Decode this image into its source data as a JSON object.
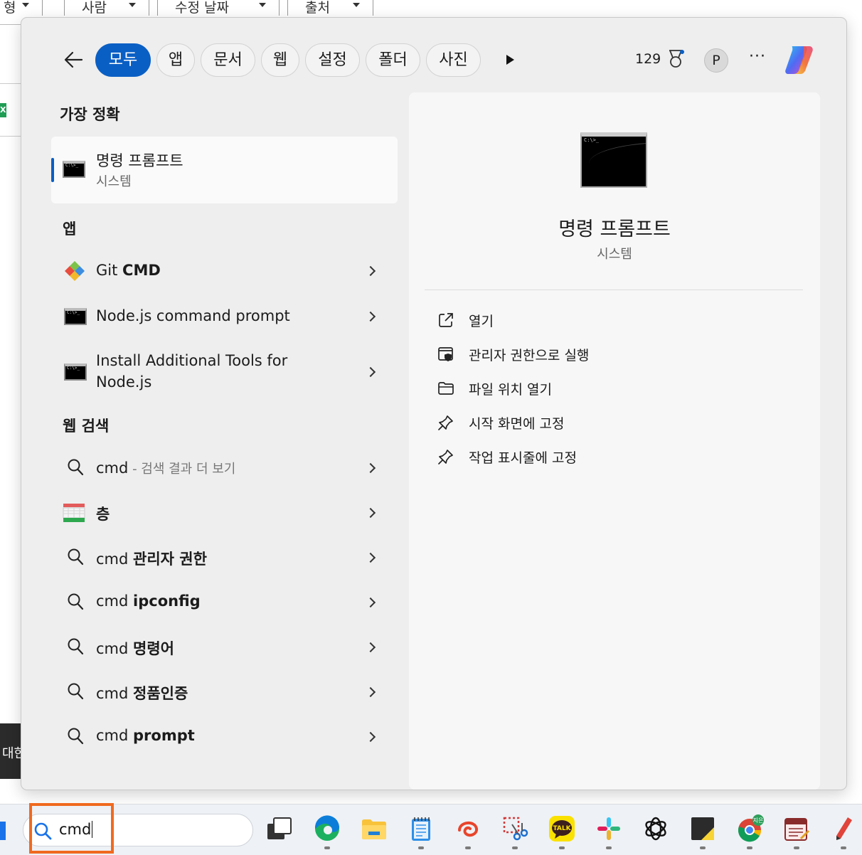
{
  "background_window": {
    "columns": [
      "형",
      "사람",
      "수정 날짜",
      "출처"
    ],
    "tooltip_text": "대한"
  },
  "filters": {
    "chips": [
      "모두",
      "앱",
      "문서",
      "웹",
      "설정",
      "폴더",
      "사진"
    ],
    "active": "모두",
    "points": "129",
    "avatar_initial": "P",
    "more": "···"
  },
  "best_match": {
    "heading": "가장 정확",
    "title": "명령 프롬프트",
    "subtitle": "시스템"
  },
  "apps": {
    "heading": "앱",
    "items": [
      {
        "prefix": "Git ",
        "bold": "CMD"
      },
      {
        "line1": "Node.js command prompt"
      },
      {
        "line1": "Install Additional Tools for",
        "line2": "Node.js"
      }
    ]
  },
  "web": {
    "heading": "웹 검색",
    "items": [
      {
        "prefix": "cmd",
        "suffix": " - 검색 결과 더 보기"
      },
      {
        "bold": "층"
      },
      {
        "prefix": "cmd ",
        "bold": "관리자 권한"
      },
      {
        "prefix": "cmd ",
        "bold": "ipconfig"
      },
      {
        "prefix": "cmd ",
        "bold": "명령어"
      },
      {
        "prefix": "cmd ",
        "bold": "정품인증"
      },
      {
        "prefix": "cmd ",
        "bold": "prompt"
      }
    ]
  },
  "detail": {
    "title": "명령 프롬프트",
    "subtitle": "시스템",
    "actions": [
      "열기",
      "관리자 권한으로 실행",
      "파일 위치 열기",
      "시작 화면에 고정",
      "작업 표시줄에 고정"
    ]
  },
  "taskbar": {
    "search_value": "cmd",
    "chrome_badge": "지은",
    "kakao_label": "TALK",
    "apps": [
      "task-view-icon",
      "edge-icon",
      "file-explorer-icon",
      "notepad-icon",
      "swirl-app-icon",
      "snipping-tool-icon",
      "kakaotalk-icon",
      "slack-icon",
      "chatgpt-icon",
      "sticky-notes-icon",
      "chrome-icon",
      "planner-icon",
      "pen-app-icon"
    ]
  },
  "colors": {
    "accent": "#0a5fc4",
    "highlight": "#f06a1f"
  }
}
